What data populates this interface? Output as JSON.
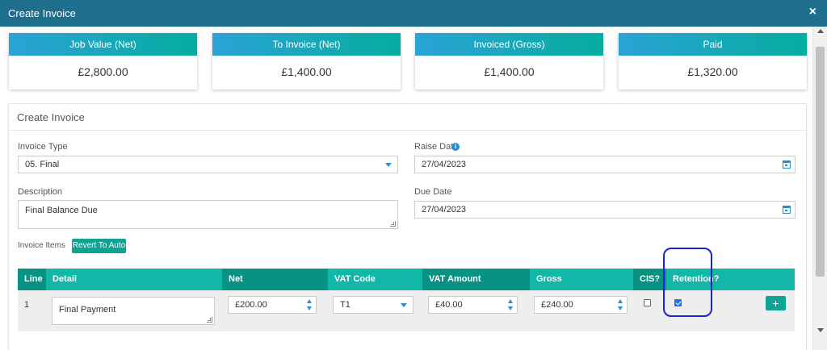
{
  "modal": {
    "title": "Create Invoice",
    "close_glyph": "×"
  },
  "summary": [
    {
      "label": "Job Value (Net)",
      "value": "£2,800.00"
    },
    {
      "label": "To Invoice (Net)",
      "value": "£1,400.00"
    },
    {
      "label": "Invoiced (Gross)",
      "value": "£1,400.00"
    },
    {
      "label": "Paid",
      "value": "£1,320.00"
    }
  ],
  "form": {
    "title": "Create Invoice",
    "invoice_type": {
      "label": "Invoice Type",
      "value": "05. Final"
    },
    "raise_date": {
      "label": "Raise Date",
      "value": "27/04/2023",
      "info_glyph": "i"
    },
    "description": {
      "label": "Description",
      "value": "Final Balance Due"
    },
    "due_date": {
      "label": "Due Date",
      "value": "27/04/2023"
    },
    "invoice_items_label": "Invoice Items",
    "revert_button": "Revert To Auto"
  },
  "table": {
    "columns": [
      "Line",
      "Detail",
      "Net",
      "VAT Code",
      "VAT Amount",
      "Gross",
      "CIS?",
      "Retention?"
    ],
    "rows": [
      {
        "line": "1",
        "detail": "Final Payment",
        "net": "£200.00",
        "vat_code": "T1",
        "vat_amount": "£40.00",
        "gross": "£240.00",
        "cis": false,
        "retention": true
      }
    ],
    "add_glyph": "+"
  },
  "colors": {
    "header_bar": "#1e6e8e",
    "teal": "#0fa394",
    "teal_light": "#12b7a8",
    "teal_dark": "#079284",
    "highlight_ring": "#1621d8"
  },
  "icons": [
    "close-icon",
    "info-icon",
    "calendar-icon",
    "chevron-down-icon",
    "spinner-icon",
    "plus-icon",
    "resize-grip-icon"
  ]
}
